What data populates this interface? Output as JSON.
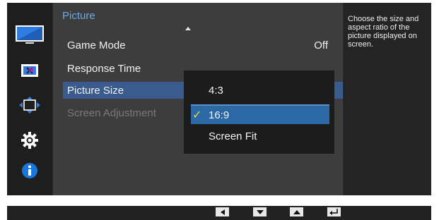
{
  "menu": {
    "title": "Picture",
    "items": [
      {
        "label": "Game Mode",
        "value": "Off",
        "state": "normal"
      },
      {
        "label": "Response Time",
        "value": "",
        "state": "normal"
      },
      {
        "label": "Picture Size",
        "value": "",
        "state": "selected"
      },
      {
        "label": "Screen Adjustment",
        "value": "",
        "state": "disabled"
      }
    ]
  },
  "submenu": {
    "options": [
      "4:3",
      "16:9",
      "Screen Fit"
    ],
    "selected": "16:9"
  },
  "help": {
    "text": "Choose the size and aspect ratio of the picture displayed on screen."
  },
  "sidebar_icons": [
    "picture-icon",
    "color-icon",
    "size-position-icon",
    "setup-gear-icon",
    "information-icon"
  ],
  "bottom_buttons": [
    "left-arrow-button",
    "down-arrow-button",
    "up-arrow-button",
    "enter-button"
  ],
  "colors": {
    "title_accent": "#6aa9e9",
    "selected_row": "#3a5b8d",
    "submenu_selected": "#2c67a6",
    "check_mark": "#e6df2a",
    "info_icon": "#1877d9"
  }
}
